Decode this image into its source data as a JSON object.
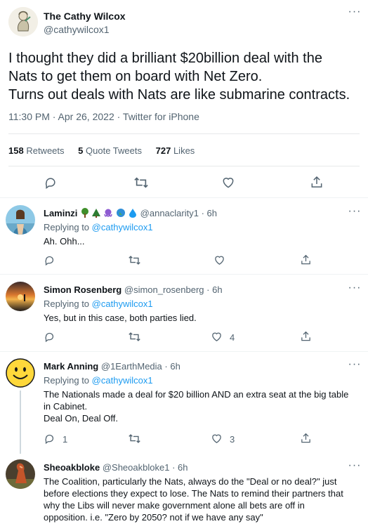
{
  "main_tweet": {
    "display_name": "The Cathy Wilcox",
    "handle": "@cathywilcox1",
    "text_lines": [
      "I thought they did a brilliant $20billion deal with the",
      "Nats to get them on board with Net Zero.",
      "Turns out deals with Nats are like submarine contracts."
    ],
    "timestamp": "11:30 PM · Apr 26, 2022 · Twitter for iPhone",
    "retweets_count": "158",
    "retweets_label": "Retweets",
    "quote_count": "5",
    "quote_label": "Quote Tweets",
    "likes_count": "727",
    "likes_label": "Likes"
  },
  "replying_to_label": "Replying to",
  "replies": [
    {
      "display_name": "Laminzi",
      "name_emojis": [
        "tree",
        "tree",
        "octopus",
        "globe",
        "droplet"
      ],
      "handle": "@annaclarity1",
      "time": "· 6h",
      "replying_to": "@cathywilcox1",
      "text_lines": [
        "Ah. Ohh..."
      ],
      "likes": ""
    },
    {
      "display_name": "Simon Rosenberg",
      "handle": "@simon_rosenberg",
      "time": "· 6h",
      "replying_to": "@cathywilcox1",
      "text_lines": [
        "Yes, but in this case, both parties lied."
      ],
      "likes": "4"
    },
    {
      "display_name": "Mark Anning",
      "handle": "@1EarthMedia",
      "time": "· 6h",
      "replying_to": "@cathywilcox1",
      "text_lines": [
        "The Nationals made a deal for $20 billion AND an extra seat at the big table",
        "in Cabinet.",
        "Deal On, Deal Off."
      ],
      "replies_count": "1",
      "likes": "3"
    },
    {
      "display_name": "Sheoakbloke",
      "handle": "@Sheoakbloke1",
      "time": "· 6h",
      "text_lines": [
        "The Coalition, particularly the Nats, always do the \"Deal or no deal?\" just",
        "before elections they expect to lose. The Nats to remind their partners that",
        "why the Libs will never make government alone all bets are off in",
        "opposition. i.e. \"Zero by 2050? not if we have any say\""
      ]
    }
  ],
  "colors": {
    "link": "#1d9bf0",
    "muted": "#536471",
    "text": "#0f1419",
    "divider": "#eff3f4"
  }
}
